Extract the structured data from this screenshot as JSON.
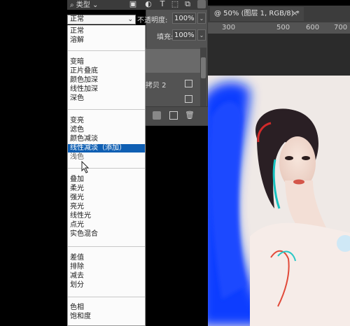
{
  "filter": {
    "label": "类型"
  },
  "blend_mode": {
    "current": "正常"
  },
  "opacity": {
    "label": "不透明度:",
    "value": "100%"
  },
  "fill": {
    "label": "填充:",
    "value": "100%"
  },
  "document_tab": {
    "title": "@ 50% (图层 1, RGB/8) *",
    "close": "×"
  },
  "ruler": {
    "ticks": [
      "300",
      "500",
      "600",
      "700"
    ]
  },
  "layers": [
    {
      "name": "拷贝 2"
    },
    {
      "name": ""
    }
  ],
  "blend_menu": {
    "groups": [
      [
        "正常",
        "溶解"
      ],
      [
        "变暗",
        "正片叠底",
        "颜色加深",
        "线性加深",
        "深色"
      ],
      [
        "变亮",
        "滤色",
        "颜色减淡",
        "线性减淡（添加）",
        "浅色"
      ],
      [
        "叠加",
        "柔光",
        "强光",
        "亮光",
        "线性光",
        "点光",
        "实色混合"
      ],
      [
        "差值",
        "排除",
        "减去",
        "划分"
      ],
      [
        "色相",
        "饱和度"
      ]
    ],
    "selected": "线性减淡（添加）",
    "hovered": "浅色"
  },
  "colors": {
    "menu_bg": "#fbfbfb",
    "selection": "#0f5fb3",
    "panel": "#535353",
    "blue_brush": "#0a3cff"
  }
}
